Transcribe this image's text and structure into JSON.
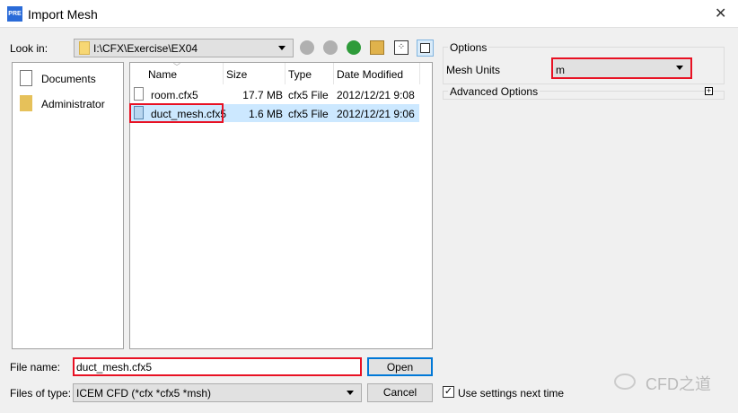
{
  "window": {
    "title": "Import Mesh",
    "app_icon": "PRE"
  },
  "look_in": {
    "label": "Look in:",
    "path": "I:\\CFX\\Exercise\\EX04"
  },
  "places": [
    {
      "label": "Documents"
    },
    {
      "label": "Administrator"
    }
  ],
  "columns": [
    "Name",
    "Size",
    "Type",
    "Date Modified"
  ],
  "files": [
    {
      "name": "room.cfx5",
      "size": "17.7 MB",
      "type": "cfx5 File",
      "date": "2012/12/21 9:08"
    },
    {
      "name": "duct_mesh.cfx5",
      "size": "1.6 MB",
      "type": "cfx5 File",
      "date": "2012/12/21 9:06"
    }
  ],
  "options": {
    "group": "Options",
    "mesh_units_label": "Mesh Units",
    "mesh_units": "m",
    "advanced": "Advanced Options"
  },
  "file_name": {
    "label": "File name:",
    "value": "duct_mesh.cfx5"
  },
  "file_type": {
    "label": "Files of type:",
    "value": "ICEM CFD (*cfx *cfx5 *msh)"
  },
  "buttons": {
    "open": "Open",
    "cancel": "Cancel"
  },
  "use_settings": {
    "label": "Use settings next time",
    "checked": true
  },
  "watermark": "CFD之道",
  "colors": {
    "highlight": "#e81123",
    "selection": "#cce8ff",
    "accent": "#0078d7"
  }
}
